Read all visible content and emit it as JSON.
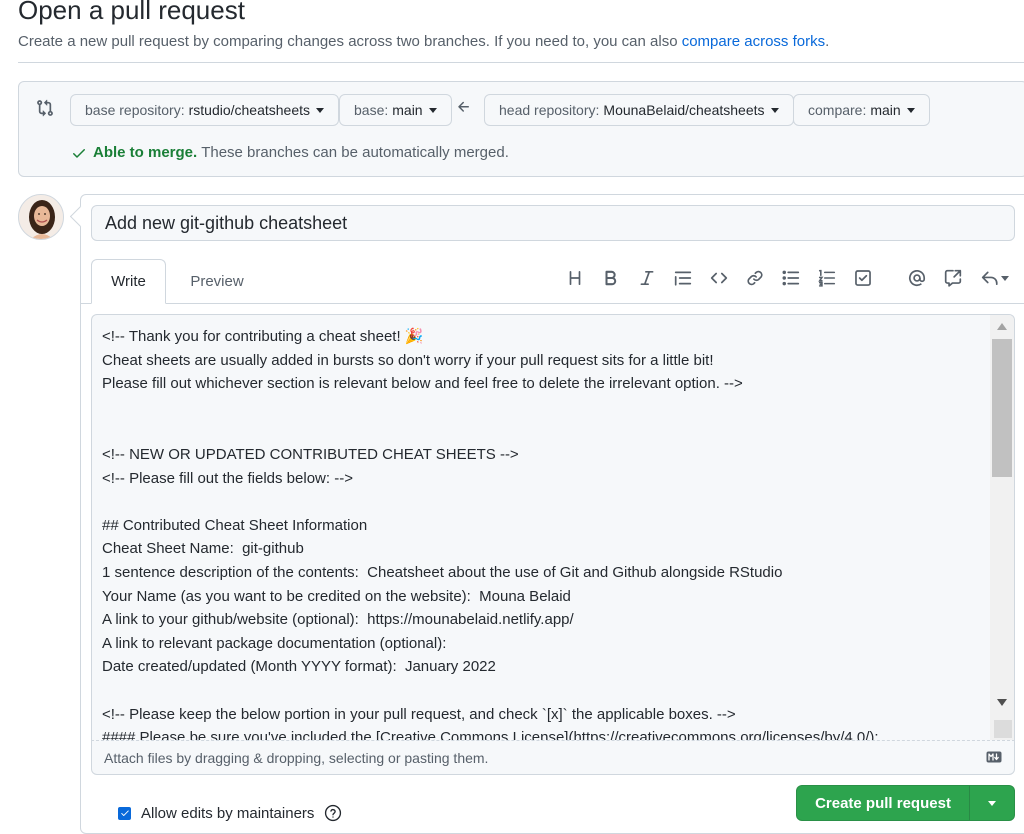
{
  "header": {
    "title": "Open a pull request",
    "subtitle": "Create a new pull request by comparing changes across two branches. If you need to, you can also",
    "compare_forks_link": "compare across forks",
    "subtitle_end": "."
  },
  "range": {
    "base_repo_label": "base repository:",
    "base_repo_value": "rstudio/cheatsheets",
    "base_label": "base:",
    "base_value": "main",
    "head_repo_label": "head repository:",
    "head_repo_value": "MounaBelaid/cheatsheets",
    "compare_label": "compare:",
    "compare_value": "main",
    "merge_status_ok": "Able to merge.",
    "merge_status_text": "These branches can be automatically merged."
  },
  "form": {
    "title_value": "Add new git-github cheatsheet",
    "tabs": {
      "write": "Write",
      "preview": "Preview"
    },
    "body": "<!-- Thank you for contributing a cheat sheet! 🎉\nCheat sheets are usually added in bursts so don't worry if your pull request sits for a little bit!\nPlease fill out whichever section is relevant below and feel free to delete the irrelevant option. -->\n\n\n<!-- NEW OR UPDATED CONTRIBUTED CHEAT SHEETS -->\n<!-- Please fill out the fields below: -->\n\n## Contributed Cheat Sheet Information\nCheat Sheet Name:  git-github\n1 sentence description of the contents:  Cheatsheet about the use of Git and Github alongside RStudio\nYour Name (as you want to be credited on the website):  Mouna Belaid\nA link to your github/website (optional):  https://mounabelaid.netlify.app/\nA link to relevant package documentation (optional):\nDate created/updated (Month YYYY format):  January 2022\n\n<!-- Please keep the below portion in your pull request, and check `[x]` the applicable boxes. -->\n#### Please be sure you've included the [Creative Commons License](https://creativecommons.org/licenses/by/4.0/):",
    "attach_text": "Attach files by dragging & dropping, selecting or pasting them.",
    "allow_edits_label": "Allow edits by maintainers",
    "allow_edits_checked": true,
    "create_button": "Create pull request"
  },
  "colors": {
    "accent": "#0969da",
    "success": "#1a7f37",
    "primary_button": "#2da44e"
  }
}
